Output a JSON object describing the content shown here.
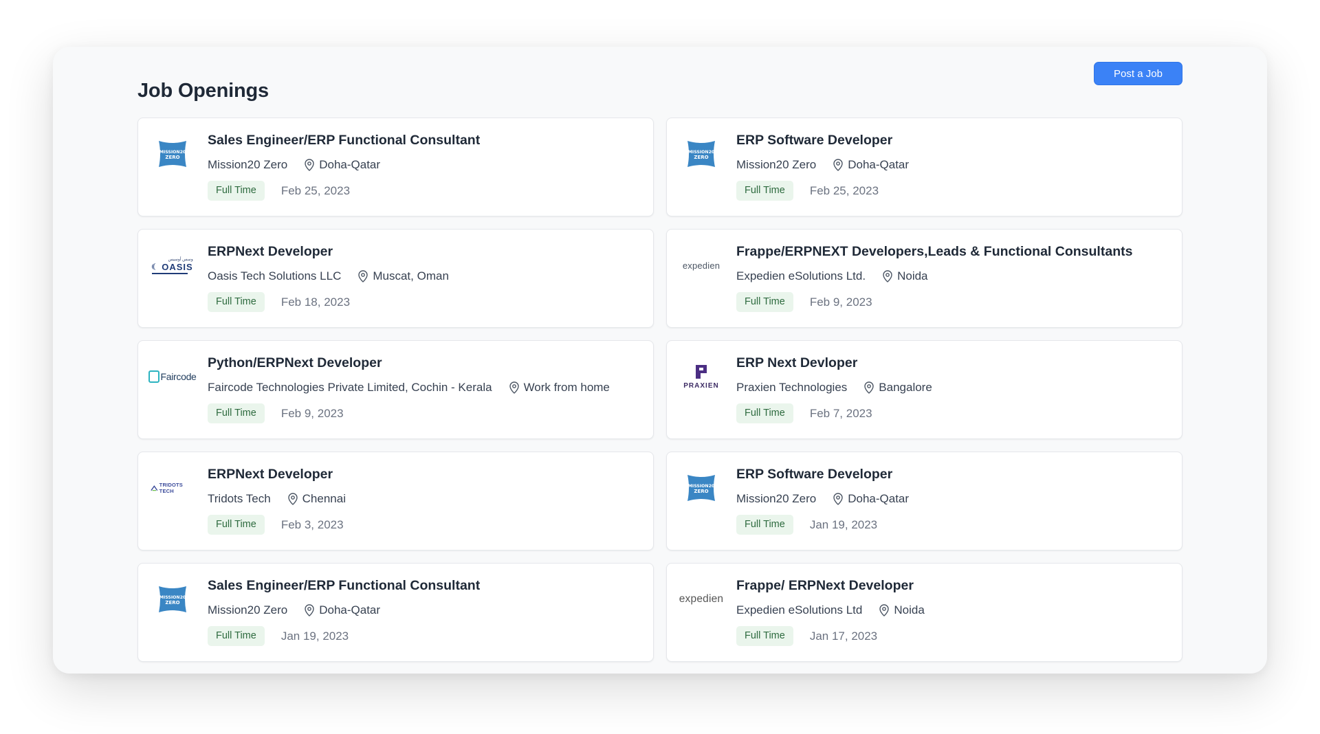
{
  "page": {
    "title": "Job Openings",
    "post_button_label": "Post a Job"
  },
  "logos": {
    "mission20": "MISSION20 ZERO",
    "oasis_arabic": "وسس أوسيس",
    "oasis": "OASIS",
    "expedien": "expedien",
    "faircode": "Faircode",
    "praxien": "PRAXIEN",
    "tridots": "TRIDOTS TECH"
  },
  "jobs": [
    {
      "title": "Sales Engineer/ERP Functional Consultant",
      "company": "Mission20 Zero",
      "location": "Doha-Qatar",
      "type": "Full Time",
      "date": "Feb 25, 2023",
      "logo": "mission20"
    },
    {
      "title": "ERP Software Developer",
      "company": "Mission20 Zero",
      "location": "Doha-Qatar",
      "type": "Full Time",
      "date": "Feb 25, 2023",
      "logo": "mission20"
    },
    {
      "title": "ERPNext Developer",
      "company": "Oasis Tech Solutions LLC",
      "location": "Muscat, Oman",
      "type": "Full Time",
      "date": "Feb 18, 2023",
      "logo": "oasis"
    },
    {
      "title": "Frappe/ERPNEXT Developers,Leads & Functional Consultants",
      "company": "Expedien eSolutions Ltd.",
      "location": "Noida",
      "type": "Full Time",
      "date": "Feb 9, 2023",
      "logo": "expedien"
    },
    {
      "title": "Python/ERPNext Developer",
      "company": "Faircode Technologies Private Limited, Cochin - Kerala",
      "location": "Work from home",
      "type": "Full Time",
      "date": "Feb 9, 2023",
      "logo": "faircode"
    },
    {
      "title": "ERP Next Devloper",
      "company": "Praxien Technologies",
      "location": "Bangalore",
      "type": "Full Time",
      "date": "Feb 7, 2023",
      "logo": "praxien"
    },
    {
      "title": "ERPNext Developer",
      "company": "Tridots Tech",
      "location": "Chennai",
      "type": "Full Time",
      "date": "Feb 3, 2023",
      "logo": "tridots"
    },
    {
      "title": "ERP Software Developer",
      "company": "Mission20 Zero",
      "location": "Doha-Qatar",
      "type": "Full Time",
      "date": "Jan 19, 2023",
      "logo": "mission20"
    },
    {
      "title": "Sales Engineer/ERP Functional Consultant",
      "company": "Mission20 Zero",
      "location": "Doha-Qatar",
      "type": "Full Time",
      "date": "Jan 19, 2023",
      "logo": "mission20"
    },
    {
      "title": "Frappe/ ERPNext Developer",
      "company": "Expedien eSolutions Ltd",
      "location": "Noida",
      "type": "Full Time",
      "date": "Jan 17, 2023",
      "logo": "expedien-large"
    }
  ],
  "colors": {
    "accent": "#3b82f6",
    "badge_bg": "#eaf5ec",
    "badge_text": "#2d6a3e",
    "mission20_blue": "#3a86c4",
    "praxien_purple": "#4b2e83"
  },
  "icons": {
    "location": "map-pin-icon"
  }
}
